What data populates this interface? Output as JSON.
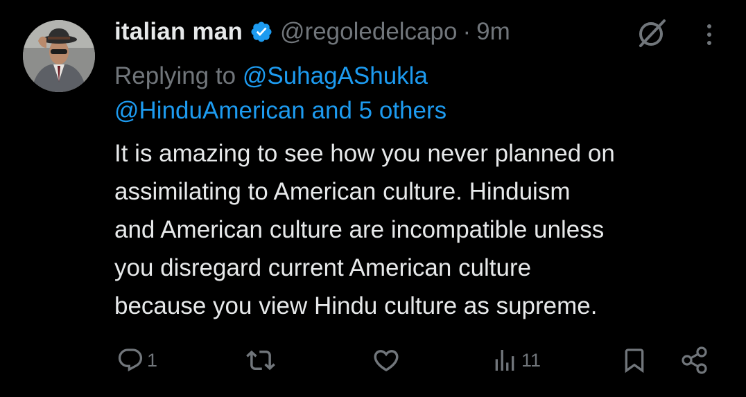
{
  "tweet": {
    "display_name": "italian man",
    "handle": "@regoledelcapo",
    "separator": "·",
    "time": "9m",
    "replying_prefix": "Replying to ",
    "reply_mention_1": "@SuhagAShukla",
    "reply_mention_2": "@HinduAmerican",
    "reply_and": " and ",
    "reply_others": "5 others",
    "text_lines": [
      "It is amazing to see how you never planned on",
      "assimilating to American culture. Hinduism",
      "and American culture are incompatible unless",
      "you disregard current American culture",
      "because you view Hindu culture as supreme."
    ]
  },
  "actions": {
    "reply_count": "1",
    "retweet_count": "",
    "like_count": "",
    "views_count": "11"
  },
  "icons": {
    "verified": "verified-badge-icon",
    "grok": "grok-icon",
    "more": "more-icon",
    "reply": "reply-icon",
    "retweet": "retweet-icon",
    "like": "heart-icon",
    "views": "views-icon",
    "bookmark": "bookmark-icon",
    "share": "share-icon"
  },
  "colors": {
    "background": "#000000",
    "text_primary": "#e7e9ea",
    "text_secondary": "#71767b",
    "accent": "#1d9bf0"
  }
}
